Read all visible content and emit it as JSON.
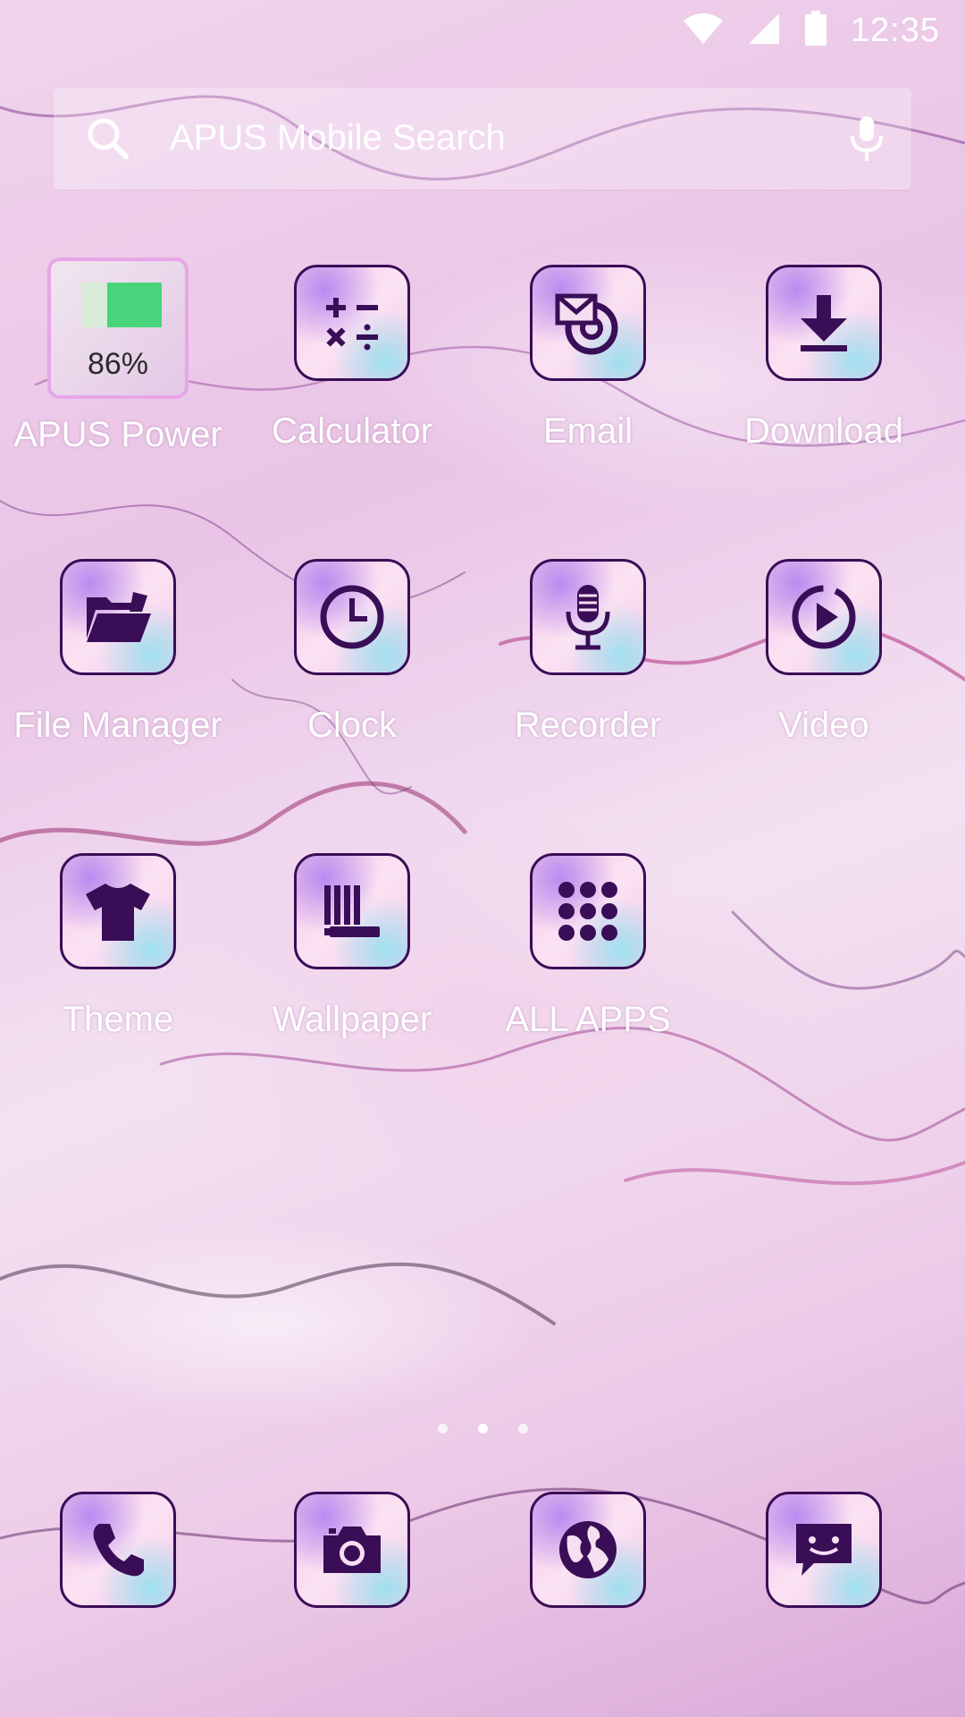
{
  "status_bar": {
    "time": "12:35"
  },
  "search": {
    "placeholder": "APUS Mobile Search"
  },
  "apps": [
    {
      "id": "apus-power",
      "label": "APUS Power",
      "icon": "battery-widget-icon",
      "battery_percent": "86%"
    },
    {
      "id": "calculator",
      "label": "Calculator",
      "icon": "calculator-icon"
    },
    {
      "id": "email",
      "label": "Email",
      "icon": "email-icon"
    },
    {
      "id": "download",
      "label": "Download",
      "icon": "download-icon"
    },
    {
      "id": "file-manager",
      "label": "File Manager",
      "icon": "folder-icon"
    },
    {
      "id": "clock",
      "label": "Clock",
      "icon": "clock-icon"
    },
    {
      "id": "recorder",
      "label": "Recorder",
      "icon": "microphone-icon"
    },
    {
      "id": "video",
      "label": "Video",
      "icon": "play-icon"
    },
    {
      "id": "theme",
      "label": "Theme",
      "icon": "tshirt-icon"
    },
    {
      "id": "wallpaper",
      "label": "Wallpaper",
      "icon": "wallpaper-icon"
    },
    {
      "id": "all-apps",
      "label": "ALL APPS",
      "icon": "grid-icon"
    }
  ],
  "dock": [
    {
      "id": "phone",
      "icon": "phone-icon"
    },
    {
      "id": "camera",
      "icon": "camera-icon"
    },
    {
      "id": "browser",
      "icon": "globe-icon"
    },
    {
      "id": "messages",
      "icon": "message-icon"
    }
  ],
  "page_indicator": {
    "count": 3,
    "active": 2
  },
  "colors": {
    "icon_glyph": "#3a0d57",
    "battery_fill": "#47d47a",
    "label": "#ffffff"
  }
}
